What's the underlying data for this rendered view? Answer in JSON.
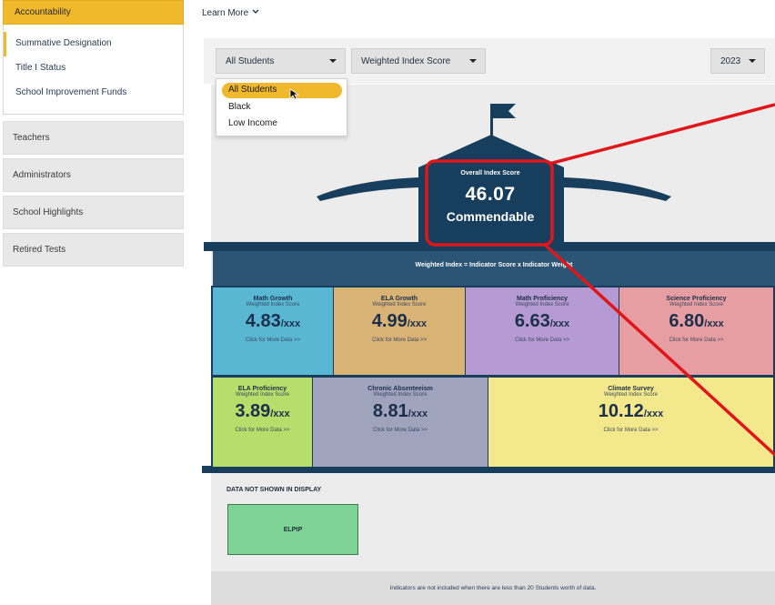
{
  "sidebar": {
    "section_label": "Accountability",
    "sub_items": [
      {
        "label": "Summative Designation",
        "active": true
      },
      {
        "label": "Title I Status",
        "active": false
      },
      {
        "label": "School Improvement Funds",
        "active": false
      }
    ],
    "items": [
      {
        "label": "Teachers"
      },
      {
        "label": "Administrators"
      },
      {
        "label": "School Highlights"
      },
      {
        "label": "Retired Tests"
      }
    ]
  },
  "header": {
    "learn_more": "Learn More"
  },
  "filters": {
    "group_select": "All Students",
    "measure_select": "Weighted Index Score",
    "year_select": "2023",
    "dropdown_options": [
      "All Students",
      "Black",
      "Low Income"
    ],
    "dropdown_highlighted": "All Students"
  },
  "overall": {
    "label": "Overall Index Score",
    "value": "46.07",
    "rating": "Commendable"
  },
  "formula": "Weighted Index = Indicator Score x Indicator Weight",
  "tile_subtitle": "Weighted Index Score",
  "tile_link": "Click for More Data >>",
  "tile_max": "/xxx",
  "tiles": [
    {
      "name": "Math Growth",
      "value": "4.83",
      "color": "#5ab7d4"
    },
    {
      "name": "ELA Growth",
      "value": "4.99",
      "color": "#d9b276"
    },
    {
      "name": "Math Proficiency",
      "value": "6.63",
      "color": "#b59ad3"
    },
    {
      "name": "Science Proficiency",
      "value": "6.80",
      "color": "#e69ea3"
    },
    {
      "name": "ELA Proficiency",
      "value": "3.89",
      "color": "#b7dd6b"
    },
    {
      "name": "Chronic Absenteeism",
      "value": "8.81",
      "color": "#9fa3bc"
    },
    {
      "name": "Climate Survey",
      "value": "10.12",
      "color": "#f3e98c"
    }
  ],
  "data_not_shown": {
    "title": "DATA NOT SHOWN IN DISPLAY",
    "items": [
      "ELPtP"
    ]
  },
  "footnote": "Indicators are not included when there are less than 20 Students worth of data.",
  "colors": {
    "accent": "#f0b82c",
    "house": "#173e5c",
    "annotation": "#e0161b"
  }
}
